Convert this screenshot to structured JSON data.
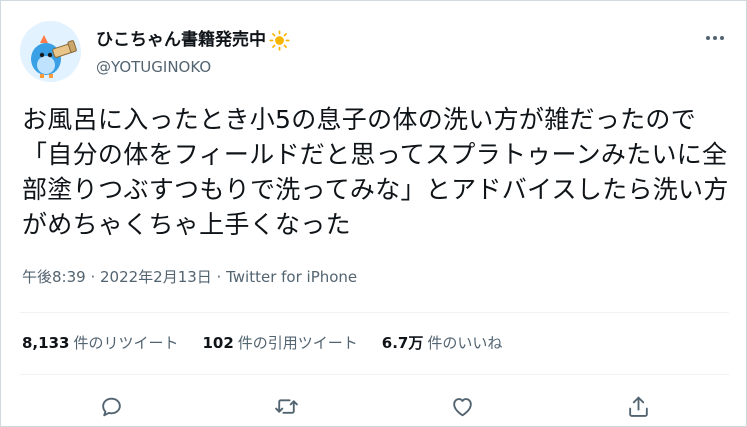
{
  "author": {
    "display_name": "ひこちゃん書籍発売中",
    "emoji_icon": "sun-icon",
    "handle": "@YOTUGINOKO"
  },
  "tweet": {
    "text": "お風呂に入ったとき小5の息子の体の洗い方が雑だったので「自分の体をフィールドだと思ってスプラトゥーンみたいに全部塗りつぶすつもりで洗ってみな」とアドバイスしたら洗い方がめちゃくちゃ上手くなった",
    "meta": "午後8:39 · 2022年2月13日 · Twitter for iPhone"
  },
  "stats": {
    "retweets_count": "8,133",
    "retweets_label": "件のリツイート",
    "quotes_count": "102",
    "quotes_label": "件の引用ツイート",
    "likes_count": "6.7万",
    "likes_label": "件のいいね"
  },
  "actions": [
    "reply-icon",
    "retweet-icon",
    "like-icon",
    "share-icon"
  ],
  "colors": {
    "text": "#0f1419",
    "secondary": "#536471",
    "divider": "#eff3f4",
    "border": "#cfd9de"
  }
}
